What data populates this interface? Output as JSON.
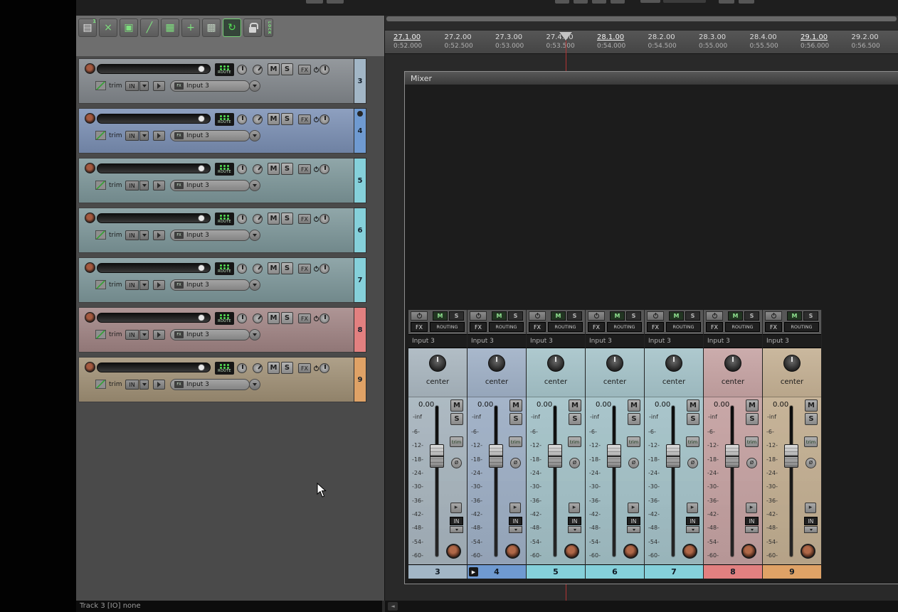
{
  "window": {
    "statusbar_text": "Track 3 [IO] none",
    "corner_btn_glyph": "◄"
  },
  "toolbar": {
    "icons": [
      {
        "name": "new-file-icon",
        "glyph": "▤",
        "color": "#e8e8e8",
        "badge": "1"
      },
      {
        "name": "media-explorer-icon",
        "glyph": "×",
        "color": "#7ee07e"
      },
      {
        "name": "item-group-icon",
        "glyph": "▣",
        "color": "#7ee07e"
      },
      {
        "name": "envelope-icon",
        "glyph": "╱",
        "color": "#7ee07e"
      },
      {
        "name": "grid-icon",
        "glyph": "▦",
        "color": "#7ee07e"
      },
      {
        "name": "crosshair-icon",
        "glyph": "+",
        "color": "#7ee07e"
      },
      {
        "name": "snap-grid-icon",
        "glyph": "▩",
        "color": "#b9c9b9"
      },
      {
        "name": "loop-icon",
        "glyph": "↻",
        "color": "#54e054",
        "pressed": true
      },
      {
        "name": "lock-icon",
        "glyph": "",
        "color": "#d8d8d8"
      },
      {
        "name": "lock-label",
        "glyph": "LOCK",
        "color": "#7ee07e",
        "vertical": true
      }
    ]
  },
  "timeline": {
    "labels": [
      {
        "measure": "27.1.00",
        "time": "0:52.000",
        "major": true
      },
      {
        "measure": "27.2.00",
        "time": "0:52.500",
        "major": false
      },
      {
        "measure": "27.3.00",
        "time": "0:53.000",
        "major": false
      },
      {
        "measure": "27.4.00",
        "time": "0:53.500",
        "major": false
      },
      {
        "measure": "28.1.00",
        "time": "0:54.000",
        "major": true
      },
      {
        "measure": "28.2.00",
        "time": "0:54.500",
        "major": false
      },
      {
        "measure": "28.3.00",
        "time": "0:55.000",
        "major": false
      },
      {
        "measure": "28.4.00",
        "time": "0:55.500",
        "major": false
      },
      {
        "measure": "29.1.00",
        "time": "0:56.000",
        "major": true
      },
      {
        "measure": "29.2.00",
        "time": "0:56.500",
        "major": false
      }
    ]
  },
  "track_panel": {
    "shared": {
      "mute": "M",
      "solo": "S",
      "fx": "FX",
      "route": "ROUTE",
      "trim": "trim",
      "in": "IN"
    },
    "tracks": [
      {
        "number": "3",
        "input": "Input 3",
        "row_tint": "#83888d",
        "num_color": "#a2b6c6"
      },
      {
        "number": "4",
        "input": "Input 3",
        "row_tint": "#7b90b5",
        "num_color": "#6f9ad1",
        "env_dot": true
      },
      {
        "number": "5",
        "input": "Input 3",
        "row_tint": "#7e989b",
        "num_color": "#85d0da"
      },
      {
        "number": "6",
        "input": "Input 3",
        "row_tint": "#7e989b",
        "num_color": "#85d0da"
      },
      {
        "number": "7",
        "input": "Input 3",
        "row_tint": "#7e989b",
        "num_color": "#85d0da"
      },
      {
        "number": "8",
        "input": "Input 3",
        "row_tint": "#a18484",
        "num_color": "#e28080"
      },
      {
        "number": "9",
        "input": "Input 3",
        "row_tint": "#a19176",
        "num_color": "#dfa266"
      }
    ]
  },
  "mixer": {
    "title": "Mixer",
    "shared": {
      "fx": "FX",
      "routing": "ROUTING",
      "mute": "M",
      "solo": "S",
      "trim": "trim",
      "in": "IN",
      "inf": "-inf",
      "phase_glyph": "ø",
      "send_glyph": "▸",
      "play_glyph": "▶",
      "scale": [
        "-6-",
        "-12-",
        "-18-",
        "-24-",
        "-30-",
        "-36-",
        "-42-",
        "-48-",
        "-54-",
        "-60-"
      ]
    },
    "channels": [
      {
        "number": "3",
        "input": "Input 3",
        "pan": "center",
        "volume": "0.00",
        "tint": "#a9b6bf",
        "num_color": "#a2b6c6"
      },
      {
        "number": "4",
        "input": "Input 3",
        "pan": "center",
        "volume": "0.00",
        "tint": "#9fb0c6",
        "num_color": "#6f9ad1",
        "badge": true
      },
      {
        "number": "5",
        "input": "Input 3",
        "pan": "center",
        "volume": "0.00",
        "tint": "#a5c3c9",
        "num_color": "#85d0da"
      },
      {
        "number": "6",
        "input": "Input 3",
        "pan": "center",
        "volume": "0.00",
        "tint": "#a5c3c9",
        "num_color": "#85d0da"
      },
      {
        "number": "7",
        "input": "Input 3",
        "pan": "center",
        "volume": "0.00",
        "tint": "#a5c3c9",
        "num_color": "#85d0da"
      },
      {
        "number": "8",
        "input": "Input 3",
        "pan": "center",
        "volume": "0.00",
        "tint": "#c6a3a3",
        "num_color": "#e28080"
      },
      {
        "number": "9",
        "input": "Input 3",
        "pan": "center",
        "volume": "0.00",
        "tint": "#c4b093",
        "num_color": "#dfa266"
      }
    ]
  }
}
